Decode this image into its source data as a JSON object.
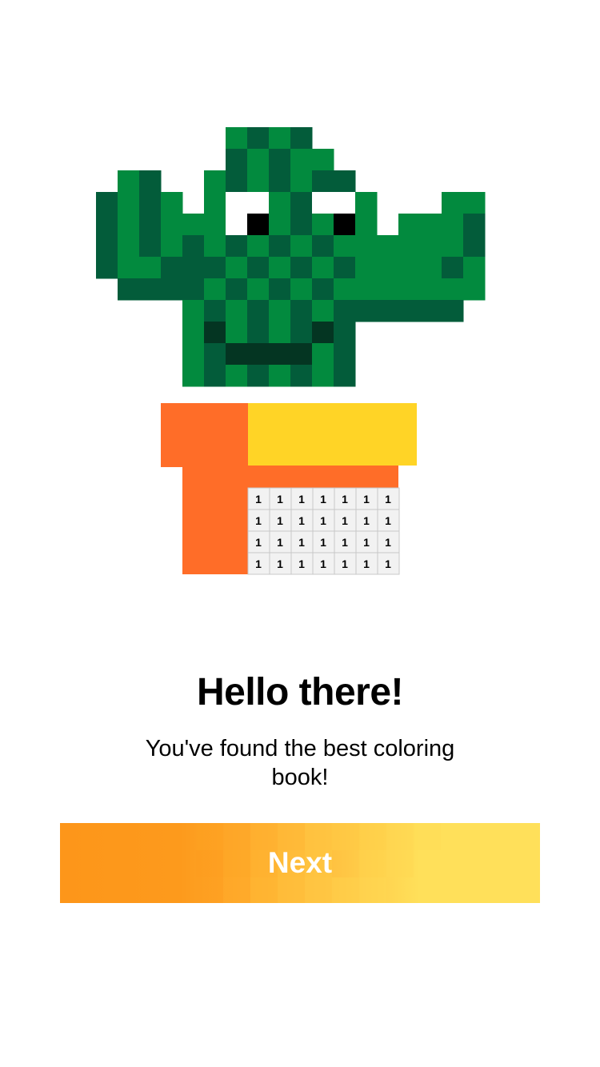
{
  "onboarding": {
    "title": "Hello there!",
    "subtitle": "You've found the best coloring book!",
    "next_label": "Next"
  },
  "illustration": {
    "subject": "pixel-art cactus in pot",
    "number_label": "1",
    "colors": {
      "light_green": "#028a3e",
      "dark_green": "#035c3a",
      "darkest_green": "#043522",
      "eye_white": "#ffffff",
      "pupil": "#000000",
      "pot_orange": "#ff6d28",
      "pot_yellow": "#ffd426",
      "unpainted_cell": "#f2f2f2",
      "cell_line": "#c8c8c8"
    }
  },
  "button_colors": {
    "start": "#fd961a",
    "end": "#ffe05a"
  }
}
